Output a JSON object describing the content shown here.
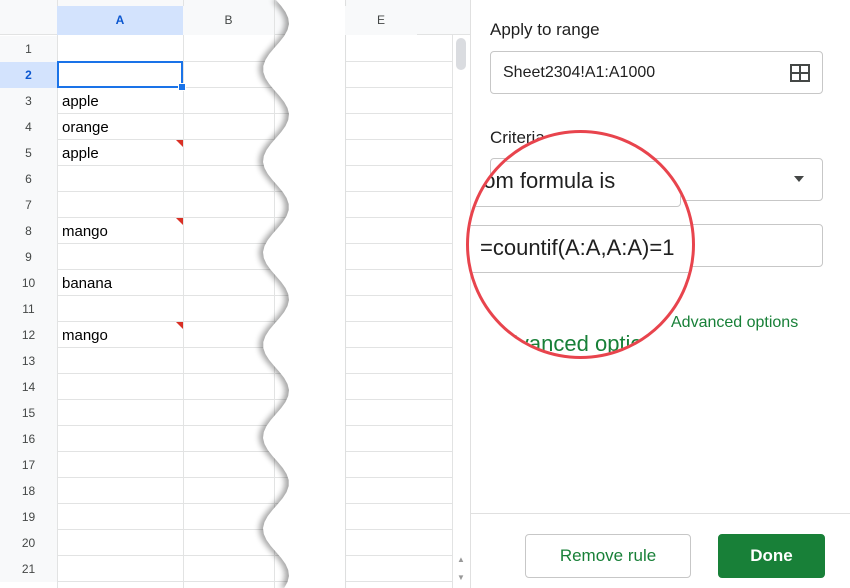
{
  "sheet": {
    "columns": [
      {
        "label": "A",
        "selected": true
      },
      {
        "label": "B",
        "selected": false
      },
      {
        "label": "E",
        "selected": false
      }
    ],
    "rows": [
      "1",
      "2",
      "3",
      "4",
      "5",
      "6",
      "7",
      "8",
      "9",
      "10",
      "11",
      "12",
      "13",
      "14",
      "15",
      "16",
      "17",
      "18",
      "19",
      "20",
      "21"
    ],
    "selected_row": "2",
    "cells": [
      {
        "row": 3,
        "value": "apple",
        "flag": false
      },
      {
        "row": 4,
        "value": "orange",
        "flag": false
      },
      {
        "row": 5,
        "value": "apple",
        "flag": true
      },
      {
        "row": 8,
        "value": "mango",
        "flag": true
      },
      {
        "row": 10,
        "value": "banana",
        "flag": false
      },
      {
        "row": 12,
        "value": "mango",
        "flag": true
      }
    ]
  },
  "panel": {
    "apply_label": "Apply to range",
    "range_value": "Sheet2304!A1:A1000",
    "criteria_label": "Criteria",
    "criteria_value": "Custom formula is",
    "formula_value": "=countif(A:A,A:A)=1",
    "advanced_label": "Advanced options",
    "remove_button": "Remove rule",
    "done_button": "Done"
  },
  "colors": {
    "accent": "#1a73e8",
    "brand_green": "#188038",
    "highlight_circle": "#e8444d",
    "duplicate_flag": "#d93025"
  }
}
